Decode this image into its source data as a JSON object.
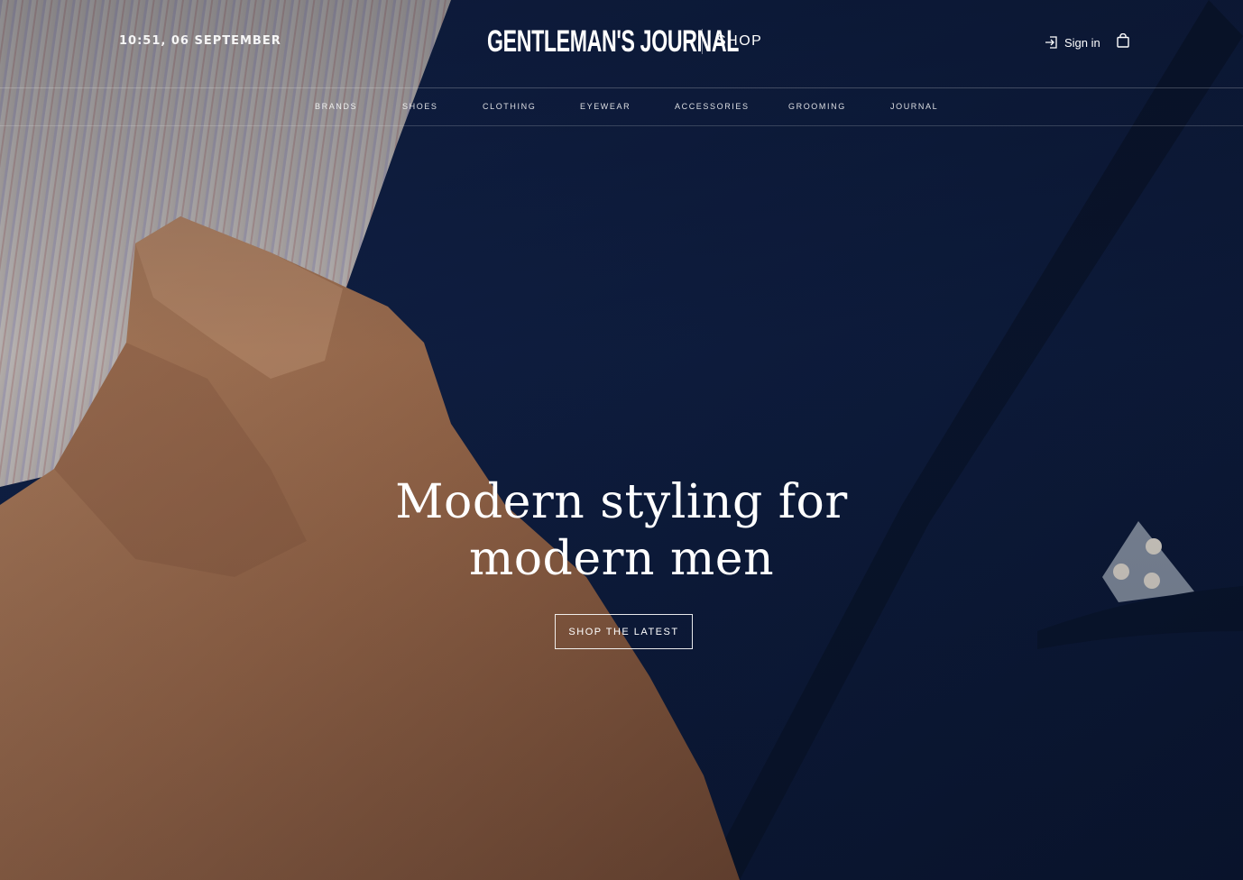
{
  "header": {
    "datetime": "10:51, 06 SEPTEMBER",
    "logo": "GENTLEMAN'S JOURNAL",
    "section": "SHOP",
    "signin_label": "Sign in",
    "signin_icon": "sign-in-icon",
    "bag_icon": "shopping-bag-icon"
  },
  "nav": {
    "items": [
      "BRANDS",
      "SHOES",
      "CLOTHING",
      "EYEWEAR",
      "ACCESSORIES",
      "GROOMING",
      "JOURNAL"
    ]
  },
  "hero": {
    "headline_line1": "Modern styling for",
    "headline_line2": "modern men",
    "cta_label": "SHOP THE LATEST"
  },
  "colors": {
    "text": "#ffffff",
    "jacket_navy": "#0d1b3a",
    "skin": "#b07a55"
  }
}
